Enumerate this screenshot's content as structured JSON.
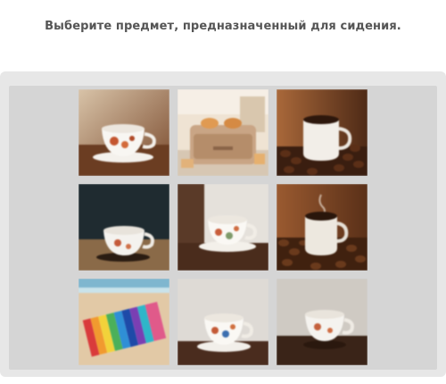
{
  "instruction": "Выберите предмет, предназначенный для сидения.",
  "tiles": [
    {
      "name": "teacup-on-table-image",
      "kind": "cup"
    },
    {
      "name": "toaster-with-bread-image",
      "kind": "toaster"
    },
    {
      "name": "coffee-mug-with-beans-image",
      "kind": "mug-beans"
    },
    {
      "name": "teacup-dark-table-image",
      "kind": "cup"
    },
    {
      "name": "teacup-on-saucer-image",
      "kind": "cup"
    },
    {
      "name": "steaming-mug-with-beans-image",
      "kind": "mug-beans"
    },
    {
      "name": "striped-towel-on-sand-image",
      "kind": "towel"
    },
    {
      "name": "teacup-on-saucer-light-image",
      "kind": "cup"
    },
    {
      "name": "teacup-dim-background-image",
      "kind": "cup"
    }
  ]
}
